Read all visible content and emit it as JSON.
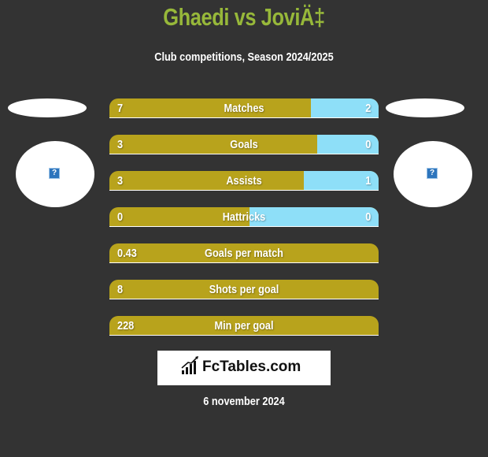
{
  "header": {
    "title": "Ghaedi vs JoviÄ‡",
    "subtitle": "Club competitions, Season 2024/2025"
  },
  "players": {
    "left": {
      "logo_icon": "broken-image-icon",
      "logo_glyph": "?"
    },
    "right": {
      "logo_icon": "broken-image-icon",
      "logo_glyph": "?"
    }
  },
  "colors": {
    "left_bar": "#b8a31c",
    "right_bar": "#8edff8",
    "title": "#97b83a",
    "background": "#333333"
  },
  "stats": [
    {
      "label": "Matches",
      "left": "7",
      "right": "2",
      "left_share": 0.749
    },
    {
      "label": "Goals",
      "left": "3",
      "right": "0",
      "left_share": 0.772
    },
    {
      "label": "Assists",
      "left": "3",
      "right": "1",
      "left_share": 0.722
    },
    {
      "label": "Hattricks",
      "left": "0",
      "right": "0",
      "left_share": 0.52
    },
    {
      "label": "Goals per match",
      "left": "0.43",
      "right": "",
      "left_share": 1
    },
    {
      "label": "Shots per goal",
      "left": "8",
      "right": "",
      "left_share": 1
    },
    {
      "label": "Min per goal",
      "left": "228",
      "right": "",
      "left_share": 1
    }
  ],
  "footer": {
    "brand": "FcTables.com",
    "brand_icon": "bar-chart-trend-icon",
    "date": "6 november 2024"
  }
}
